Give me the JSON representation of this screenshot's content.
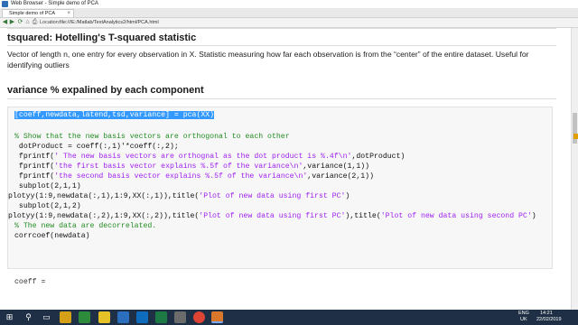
{
  "window": {
    "title": "Web Browser - Simple demo of PCA"
  },
  "tab": {
    "label": "Simple demo of PCA",
    "close": "×"
  },
  "toolbar": {
    "location_label": "Location:",
    "location_value": "file:///E:/Matlab/TextAnalytics2/html/PCA.html",
    "back": "◀",
    "forward": "▶",
    "refresh": "⟳",
    "home": "⌂",
    "print": "⎙"
  },
  "content": {
    "section1": {
      "heading": "tsquared: Hotelling's T-squared statistic",
      "body": "Vector of length n, one entry for every observation in X. Statistic measuring how far each observation is from the “center” of the entire dataset. Useful for identifying outliers"
    },
    "section2": {
      "heading": "variance % expalined by each component"
    },
    "code": {
      "line1_selected": "[coeff,newdata,latend,tsd,variance] = pca(XX)",
      "line2": "% Show that the new basis vectors are orthogonal to each other",
      "line3": " dotProduct = coeff(:,1)'*coeff(:,2);",
      "line4_a": " fprintf(",
      "line4_b": "' The new basis vectors are orthognal as the dot product is %.4f\\n'",
      "line4_c": ",dotProduct)",
      "line5_a": " fprintf(",
      "line5_b": "'the first basis vector explains %.5f of the variance\\n'",
      "line5_c": ",variance(1,1))",
      "line6_a": " fprintf(",
      "line6_b": "'the second basis vector explains %.5f of the variance\\n'",
      "line6_c": ",variance(2,1))",
      "line7": " subplot(2,1,1)",
      "line8_a": "plotyy(1:9,newdata(:,1),1:9,XX(:,1)),title(",
      "line8_b": "'Plot of new data using first PC'",
      "line8_c": ")",
      "line9": " subplot(2,1,2)",
      "line10_a": "plotyy(1:9,newdata(:,2),1:9,XX(:,2)),title(",
      "line10_b": "'Plot of new data using first PC'",
      "line10_c": "),title(",
      "line10_d": "'Plot of new data using second PC'",
      "line10_e": ")",
      "line11": "% The new data are decorrelated.",
      "line12": "corrcoef(newdata)"
    },
    "output": {
      "line": "coeff ="
    }
  },
  "taskbar": {
    "lang": "ENG",
    "region": "UK",
    "time": "14:21",
    "date": "22/02/2019",
    "colors": {
      "bg": "#1f2f45"
    }
  }
}
